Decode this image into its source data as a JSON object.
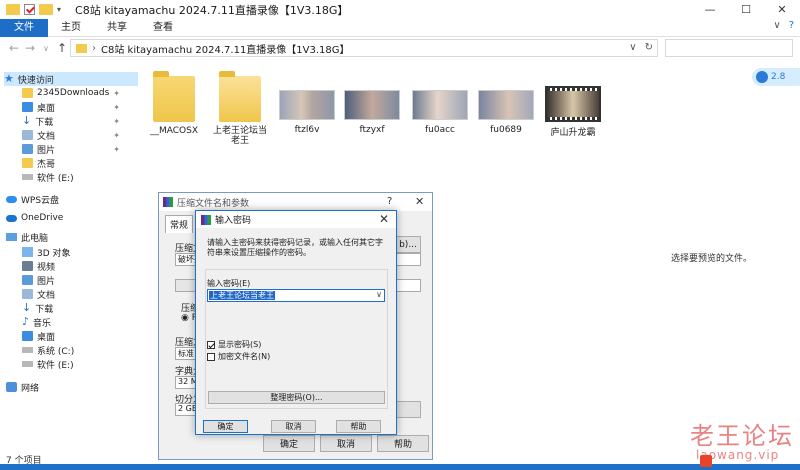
{
  "window": {
    "title": "C8站 kitayamachu 2024.7.11直播录像【1V3.18G】",
    "min_icon": "—",
    "max_icon": "☐",
    "close_icon": "✕"
  },
  "ribbon": {
    "tabs": [
      "文件",
      "主页",
      "共享",
      "查看"
    ],
    "help_icon": "?",
    "collapse_icon": "∨"
  },
  "address": {
    "back": "←",
    "forward": "→",
    "recent": "∨",
    "up": "↑",
    "path": "C8站 kitayamachu 2024.7.11直播录像【1V3.18G】",
    "separator": "›",
    "dropdown": "∨",
    "refresh": "↻"
  },
  "sidebar": {
    "items": [
      {
        "label": "快速访问",
        "icon": "star-icon"
      },
      {
        "label": "2345Downloads",
        "icon": "folder-icon",
        "pinned": true
      },
      {
        "label": "桌面",
        "icon": "desktop-icon",
        "pinned": true
      },
      {
        "label": "下载",
        "icon": "download-icon",
        "pinned": true
      },
      {
        "label": "文档",
        "icon": "document-icon",
        "pinned": true
      },
      {
        "label": "图片",
        "icon": "picture-icon",
        "pinned": true
      },
      {
        "label": "杰哥",
        "icon": "folder-icon"
      },
      {
        "label": "软件 (E:)",
        "icon": "drive-icon"
      },
      {
        "label": "WPS云盘",
        "icon": "cloud-icon"
      },
      {
        "label": "OneDrive",
        "icon": "onedrive-icon"
      },
      {
        "label": "此电脑",
        "icon": "pc-icon"
      },
      {
        "label": "3D 对象",
        "icon": "3d-icon"
      },
      {
        "label": "视频",
        "icon": "video-icon"
      },
      {
        "label": "图片",
        "icon": "picture-icon"
      },
      {
        "label": "文档",
        "icon": "document-icon"
      },
      {
        "label": "下载",
        "icon": "download-icon"
      },
      {
        "label": "音乐",
        "icon": "music-icon"
      },
      {
        "label": "桌面",
        "icon": "desktop-icon"
      },
      {
        "label": "系统 (C:)",
        "icon": "drive-icon"
      },
      {
        "label": "软件 (E:)",
        "icon": "drive-icon"
      },
      {
        "label": "网络",
        "icon": "network-icon"
      }
    ],
    "pin_glyph": "📌"
  },
  "files": [
    {
      "name": "__MACOSX",
      "type": "folder"
    },
    {
      "name": "上老王论坛当老王",
      "type": "folder"
    },
    {
      "name": "ftzl6v",
      "type": "video"
    },
    {
      "name": "ftzyxf",
      "type": "video"
    },
    {
      "name": "fu0acc",
      "type": "video"
    },
    {
      "name": "fu0689",
      "type": "video"
    },
    {
      "name": "庐山升龙霸",
      "type": "video"
    }
  ],
  "preview_pane": {
    "message": "选择要预览的文件。"
  },
  "status_bar": {
    "count": "7 个项目"
  },
  "side_badge": {
    "text": "2.8"
  },
  "bg_dialog": {
    "title": "压缩文件名和参数",
    "help": "?",
    "close": "✕",
    "tab": "常规",
    "labels": [
      "压缩文",
      "破坏死",
      "压缩",
      "RA",
      "压缩方",
      "标准",
      "字典大",
      "32 MB",
      "切分为",
      "2 GB"
    ],
    "browse_label": "b)...",
    "ok": "确定",
    "cancel": "取消",
    "help_btn": "帮助"
  },
  "pw_dialog": {
    "title": "输入密码",
    "close": "✕",
    "description": "请输入主密码来获得密码记录，或输入任何其它字符串来设置压缩操作的密码。",
    "field_label": "输入密码(E)",
    "password_value": "上老王论坛当老王",
    "field_dropdown": "∨",
    "show_password": "显示密码(S)",
    "encrypt_names": "加密文件名(N)",
    "manage_button": "整理密码(O)...",
    "ok": "确定",
    "cancel": "取消",
    "help": "帮助"
  },
  "watermark": {
    "text": "老王论坛",
    "url": "laowang.vip"
  },
  "colors": {
    "accent": "#1e70c8",
    "selection": "#cce8ff",
    "folder": "#f3c94e",
    "watermark": "#e25a5a"
  }
}
